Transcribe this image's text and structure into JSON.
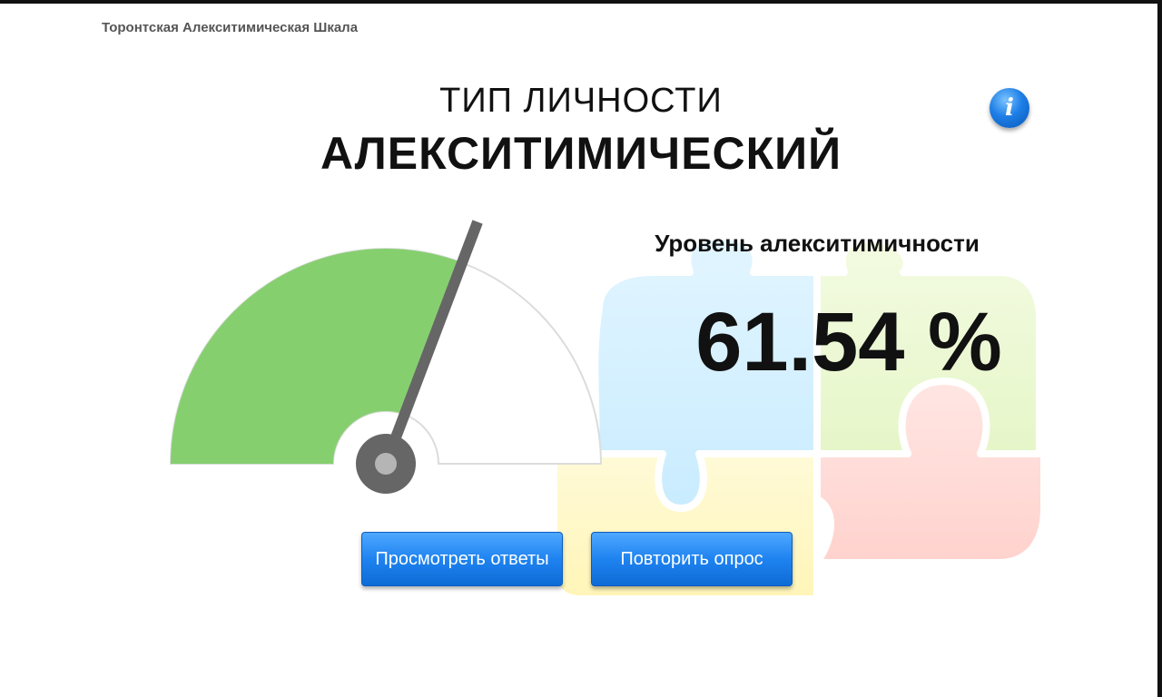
{
  "app": {
    "title": "Торонтская Алекситимическая Шкала"
  },
  "result": {
    "type_heading": "ТИП ЛИЧНОСТИ",
    "type_value": "АЛЕКСИТИМИЧЕСКИЙ",
    "level_label": "Уровень алекситимичности",
    "level_value": "61.54 %",
    "level_fraction": 0.6154
  },
  "gauge": {
    "filled_color": "#86cf6f",
    "track_color": "#ffffff",
    "needle_color": "#666666",
    "needle_hub_color": "#b5b5b5"
  },
  "buttons": {
    "view_answers": "Просмотреть ответы",
    "retry": "Повторить опрос"
  },
  "icons": {
    "info": "info-icon",
    "background": "puzzle-pieces-icon"
  }
}
